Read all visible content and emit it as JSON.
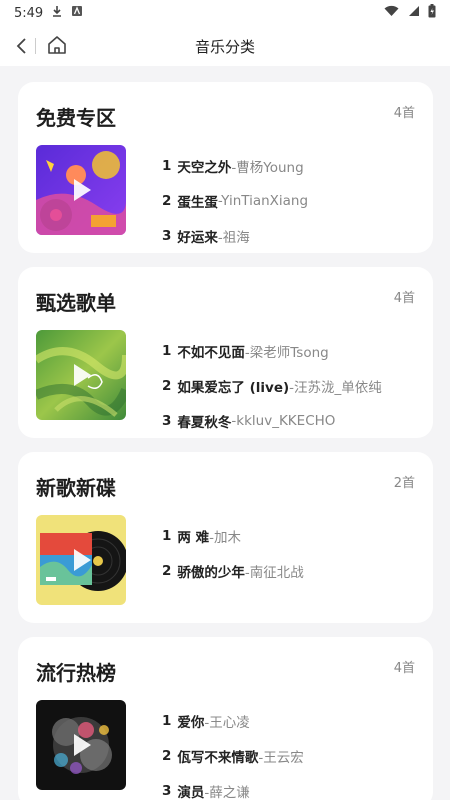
{
  "status": {
    "time": "5:49",
    "icons": [
      "download-icon",
      "app-a-icon",
      "wifi-icon",
      "signal-icon",
      "battery-icon"
    ]
  },
  "header": {
    "title": "音乐分类",
    "back_icon": "back-chevron-icon",
    "home_icon": "home-icon"
  },
  "categories": [
    {
      "title": "免费专区",
      "count": "4首",
      "cover": "festival",
      "tracks": [
        {
          "num": "1",
          "name": "天空之外",
          "artist": "-曹杨Young"
        },
        {
          "num": "2",
          "name": "蛋生蛋",
          "artist": "-YinTianXiang"
        },
        {
          "num": "3",
          "name": "好运来",
          "artist": "-祖海"
        }
      ]
    },
    {
      "title": "甄选歌单",
      "count": "4首",
      "cover": "green",
      "tracks": [
        {
          "num": "1",
          "name": "不如不见面",
          "artist": "-梁老师Tsong"
        },
        {
          "num": "2",
          "name": "如果爱忘了 (live)",
          "artist": "-汪苏泷_单依纯"
        },
        {
          "num": "3",
          "name": "春夏秋冬",
          "artist": "-kkluv_KKECHO"
        }
      ]
    },
    {
      "title": "新歌新碟",
      "count": "2首",
      "cover": "vinyl",
      "tracks": [
        {
          "num": "1",
          "name": "两 难",
          "artist": "-加木"
        },
        {
          "num": "2",
          "name": "骄傲的少年",
          "artist": "-南征北战"
        }
      ]
    },
    {
      "title": "流行热榜",
      "count": "4首",
      "cover": "dark",
      "tracks": [
        {
          "num": "1",
          "name": "爱你",
          "artist": "-王心凌"
        },
        {
          "num": "2",
          "name": "佤写不来情歌",
          "artist": "-王云宏"
        },
        {
          "num": "3",
          "name": "演员",
          "artist": "-薛之谦"
        }
      ]
    }
  ],
  "colors": {
    "background": "#f4f4f6",
    "card": "#ffffff",
    "artist_text": "#888888"
  }
}
